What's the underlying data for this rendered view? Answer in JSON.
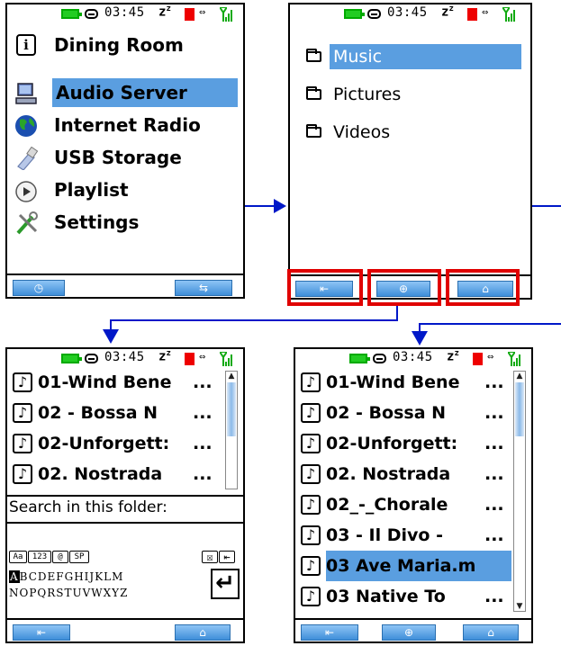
{
  "status": {
    "time": "03:45",
    "sleep_z": "z",
    "sleep_sup": "z"
  },
  "screen1": {
    "title": "Dining Room",
    "menu": [
      {
        "label": "Audio Server",
        "icon": "computer-icon"
      },
      {
        "label": "Internet Radio",
        "icon": "globe-icon"
      },
      {
        "label": "USB Storage",
        "icon": "usb-icon"
      },
      {
        "label": "Playlist",
        "icon": "play-icon"
      },
      {
        "label": "Settings",
        "icon": "tools-icon"
      }
    ],
    "softkeys": {
      "left": "clock-icon",
      "right": "swap-arrows-icon"
    }
  },
  "screen2": {
    "folders": [
      "Music",
      "Pictures",
      "Videos"
    ],
    "softkeys": {
      "left": "back-icon",
      "center": "add-icon",
      "right": "home-icon"
    }
  },
  "screen3": {
    "tracks": [
      "01-Wind Bene",
      "02 - Bossa N",
      "02-Unforgett:",
      "02. Nostrada"
    ],
    "search_label": "Search in this folder:",
    "search_value": "",
    "mode_keys": [
      "Aa",
      "123",
      "@",
      "SP"
    ],
    "clear_key": "☒",
    "backspace_key": "⇤",
    "row1_highlight": "A",
    "row1_rest": "BCDEFGHIJKLM",
    "row2": "NOPQRSTUVWXYZ",
    "enter_key": "↵"
  },
  "screen4": {
    "tracks": [
      "01-Wind Bene",
      "02 - Bossa N",
      "02-Unforgett:",
      "02. Nostrada",
      "02_-_Chorale",
      "03 - Il Divo -",
      "03 Ave Maria.m",
      "03 Native To"
    ],
    "selected_index": 6
  },
  "ellipsis": "...",
  "note_glyph": "♪",
  "colors": {
    "highlight": "#5a9ee0",
    "callout": "#e00000",
    "connector": "#0018c8",
    "battery": "#22cc22"
  }
}
